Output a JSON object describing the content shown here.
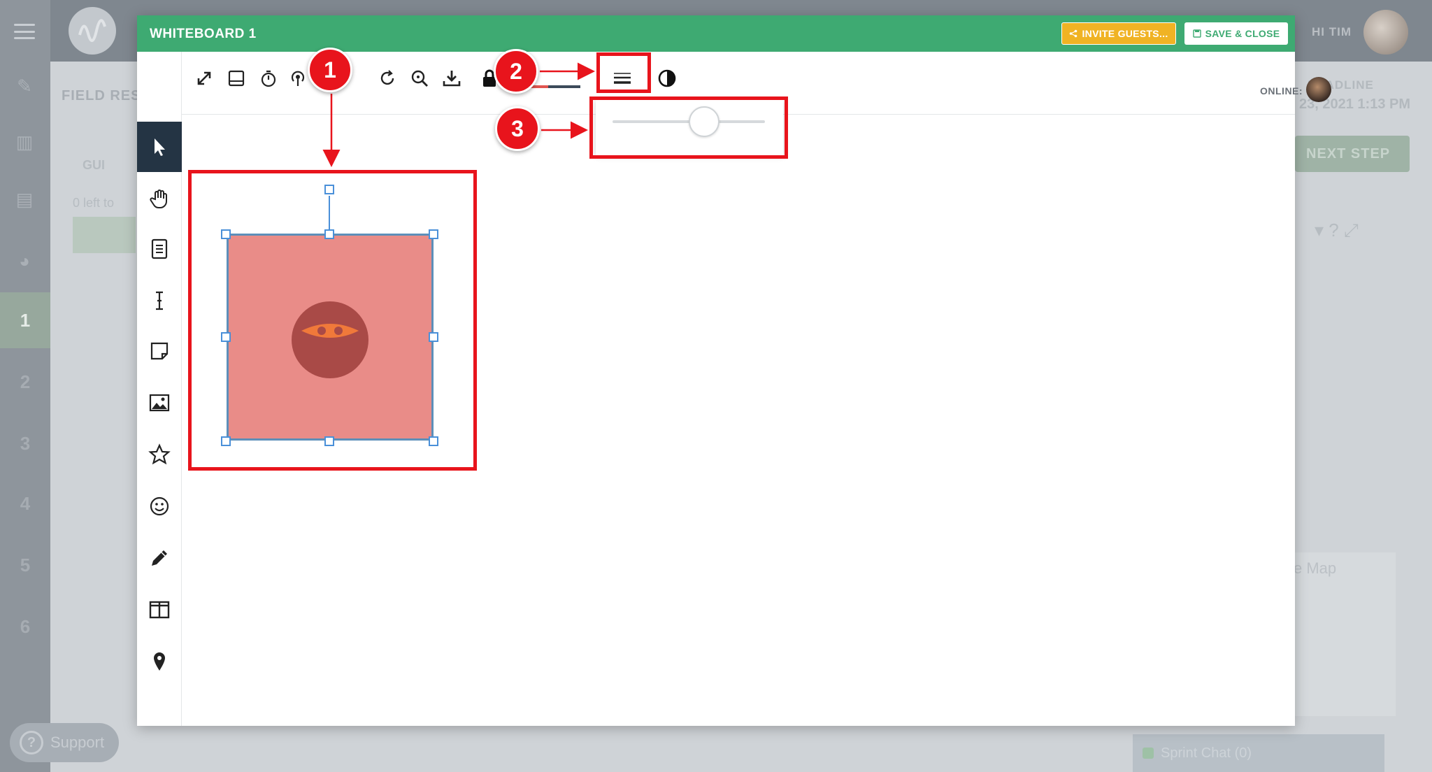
{
  "background": {
    "hi_text": "HI TIM",
    "field_text": "FIELD RES",
    "guide_text": "GUI",
    "left_text": "0 left to",
    "deadline_label": "DEADLINE",
    "deadline_value": "23, 2021 1:13 PM",
    "next_step": "NEXT STEP",
    "map_title": "e Map",
    "steps": [
      "1",
      "2",
      "3",
      "4",
      "5",
      "6"
    ],
    "support": "Support",
    "chat": "Sprint Chat (0)"
  },
  "modal": {
    "title": "WHITEBOARD 1",
    "invite_label": "INVITE GUESTS...",
    "save_label": "SAVE & CLOSE",
    "online_label": "ONLINE:"
  },
  "toolbar": {
    "icons": [
      "expand-icon",
      "tablet-icon",
      "timer-icon",
      "broadcast-icon",
      "rotate-icon",
      "zoom-icon",
      "download-icon",
      "lock-icon",
      "fill-color-icon",
      "stroke-color-icon",
      "line-weight-icon",
      "opacity-icon"
    ]
  },
  "rail": {
    "tools": [
      "select-pointer-icon",
      "hand-pan-icon",
      "document-icon",
      "text-cursor-icon",
      "sticky-note-icon",
      "image-icon",
      "star-icon",
      "emoji-icon",
      "pencil-icon",
      "columns-layout-icon",
      "map-pin-icon"
    ]
  },
  "slider": {
    "opacity_percent": 60
  },
  "callouts": {
    "c1": "1",
    "c2": "2",
    "c3": "3"
  },
  "colors": {
    "header_green": "#3eaa72",
    "invite_orange": "#f0b324",
    "annotation_red": "#e8141c",
    "image_bg": "#e98c88",
    "ninja": "#a94a47",
    "rail_active": "#243444"
  }
}
